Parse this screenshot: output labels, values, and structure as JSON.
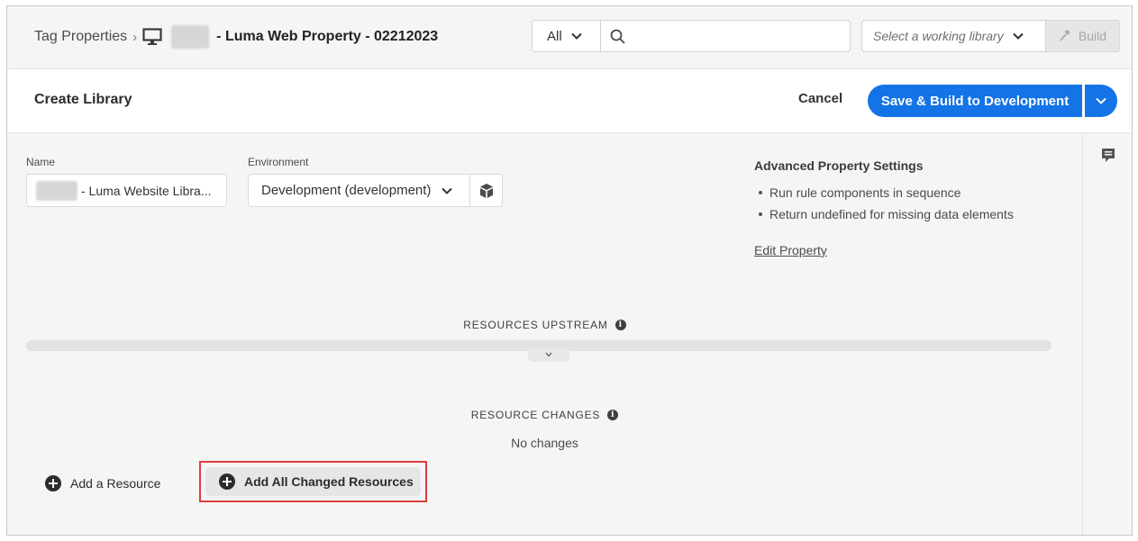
{
  "topbar": {
    "breadcrumb_root": "Tag Properties",
    "breadcrumb_sep": "›",
    "property_name": "- Luma Web Property - 02212023",
    "filter_value": "All",
    "search_placeholder": "",
    "library_placeholder": "Select a working library",
    "build_label": "Build"
  },
  "header": {
    "title": "Create Library",
    "cancel_label": "Cancel",
    "save_label": "Save & Build to Development"
  },
  "form": {
    "name_label": "Name",
    "name_value": "- Luma Website Libra...",
    "environment_label": "Environment",
    "environment_value": "Development (development)"
  },
  "advanced": {
    "title": "Advanced Property Settings",
    "items": [
      "Run rule components in sequence",
      "Return undefined for missing data elements"
    ],
    "edit_link": "Edit Property"
  },
  "resources": {
    "upstream_title": "RESOURCES UPSTREAM",
    "changes_title": "RESOURCE CHANGES",
    "no_changes": "No changes",
    "add_resource_label": "Add a Resource",
    "add_all_label": "Add All Changed Resources"
  },
  "icons": {
    "monitor": "monitor-icon",
    "search": "search-icon",
    "hammer": "hammer-icon",
    "comment": "comment-icon",
    "info": "info-icon",
    "package": "package-icon",
    "plus": "plus-circle-icon"
  },
  "colors": {
    "accent": "#1473e6",
    "highlight": "#e03c3c"
  }
}
